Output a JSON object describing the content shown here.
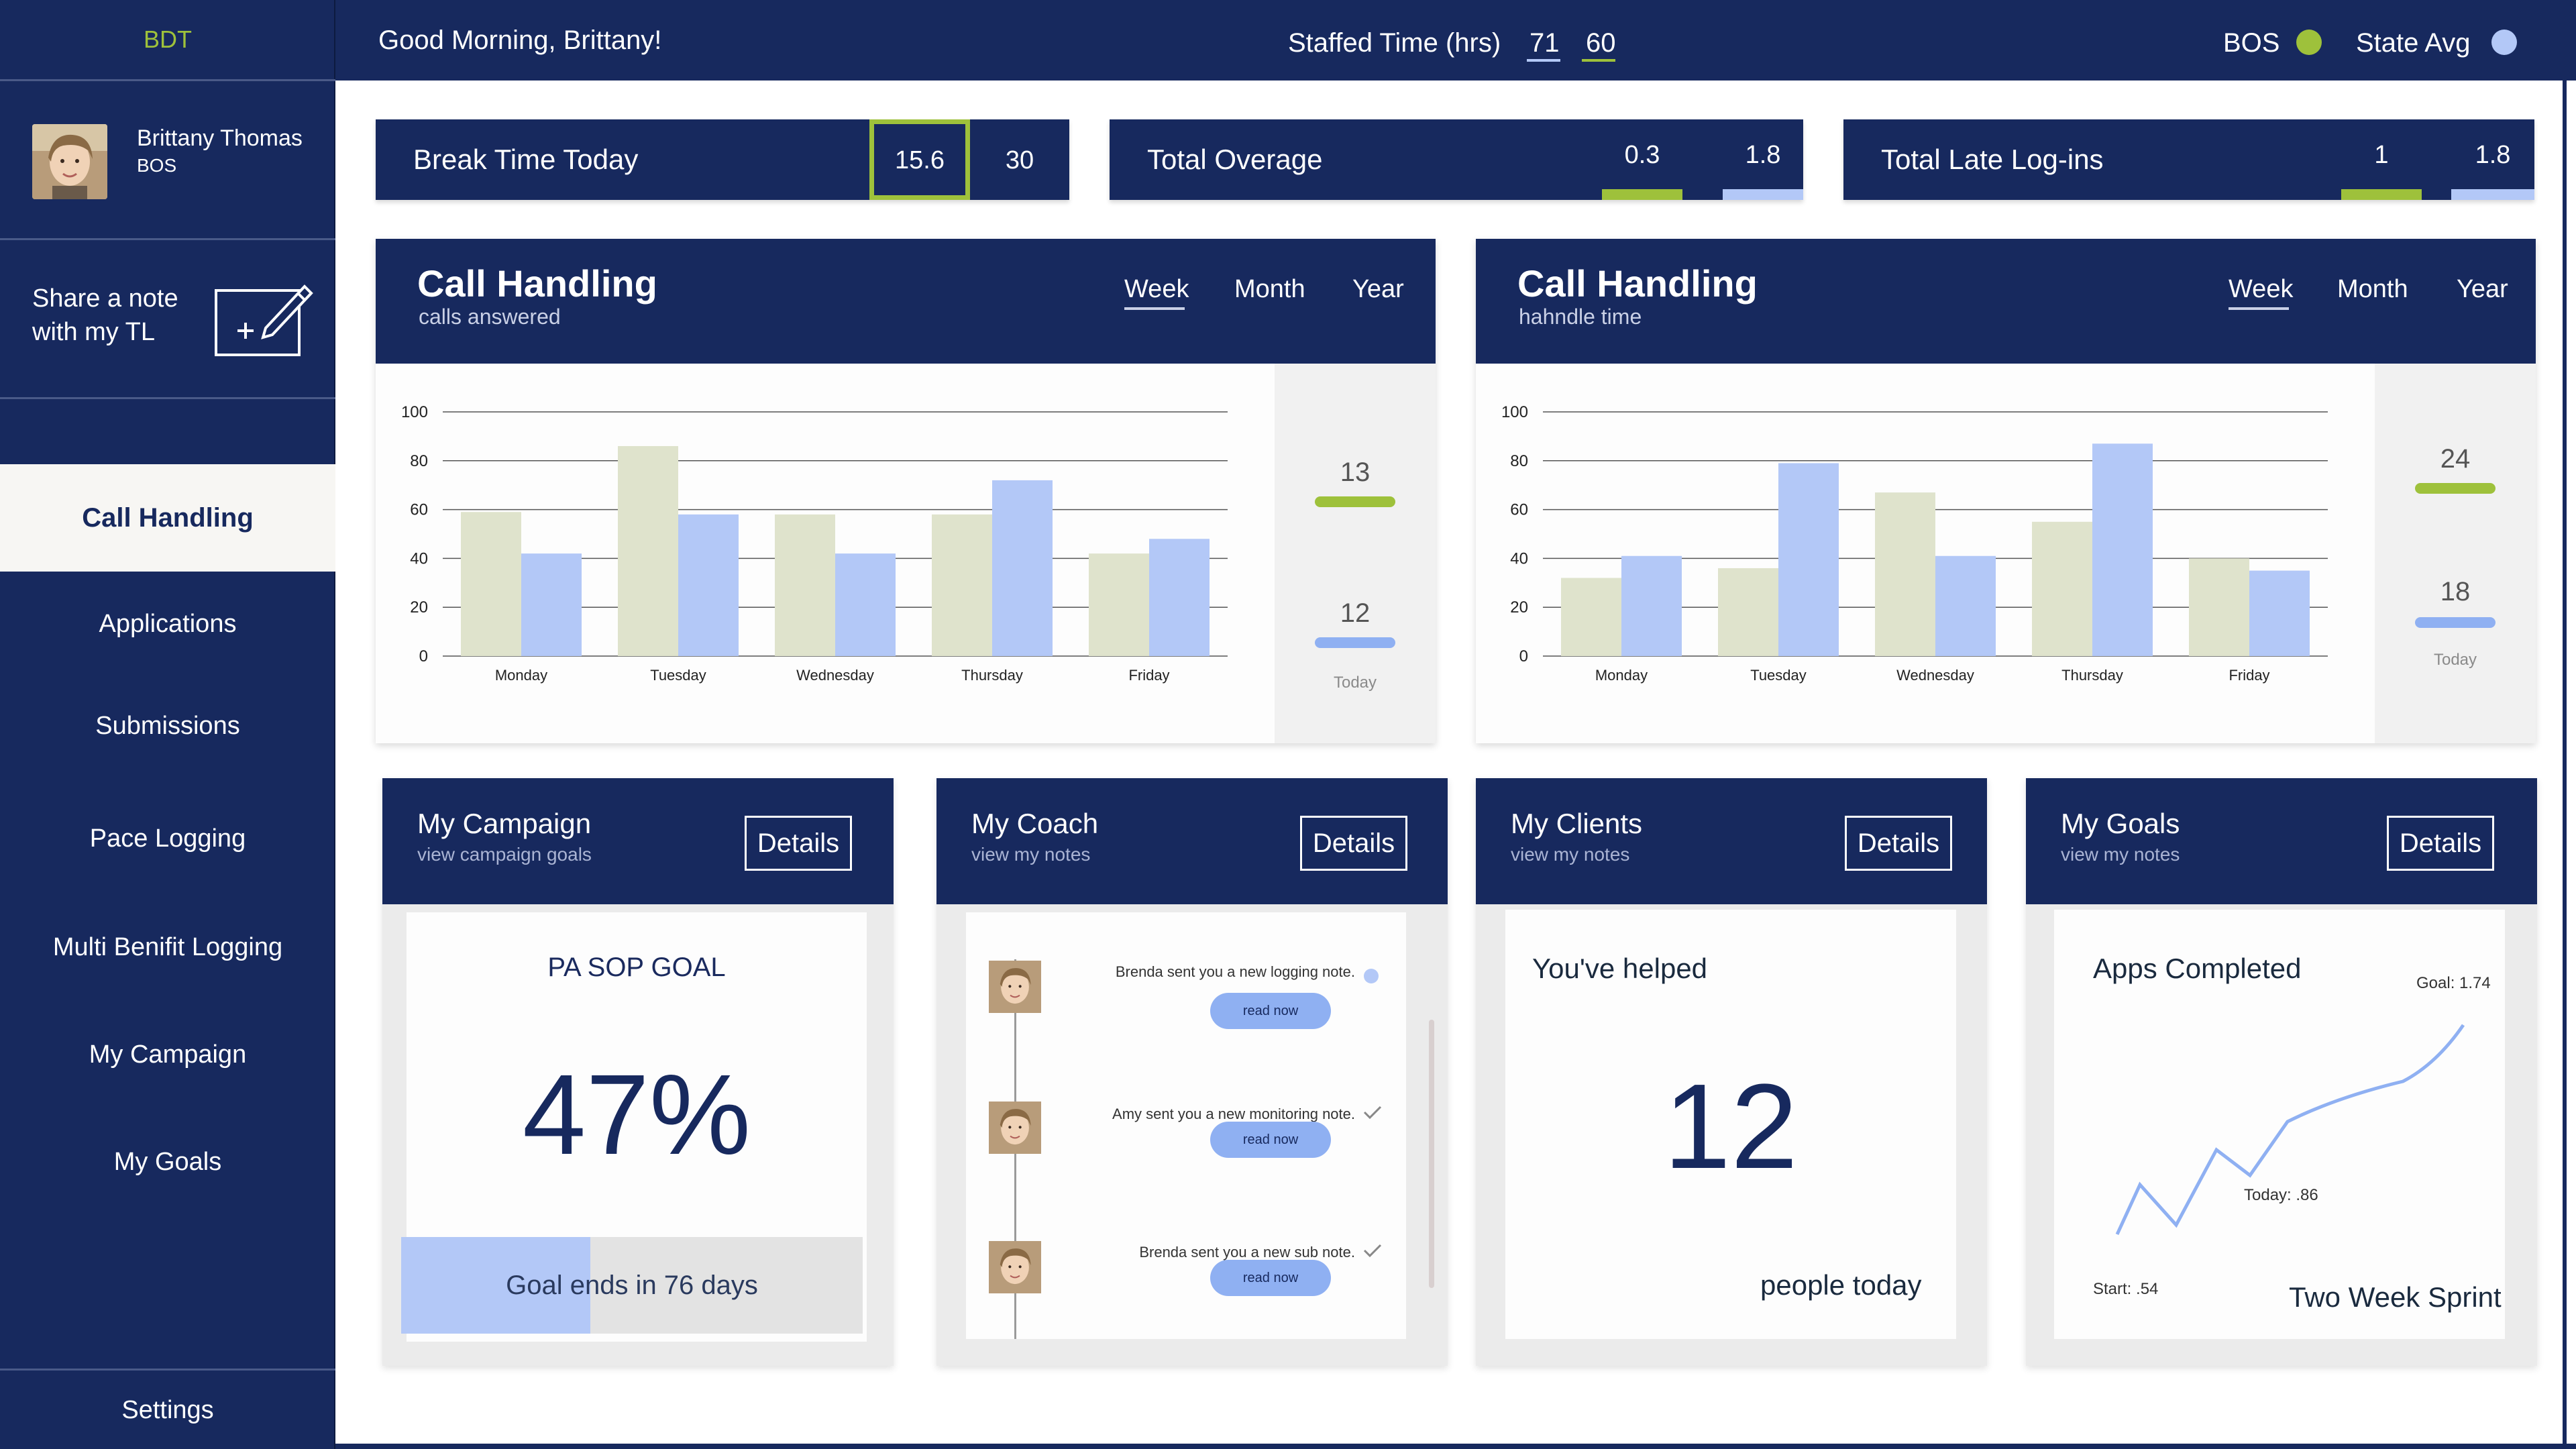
{
  "sidebar": {
    "brand": "BDT",
    "profile": {
      "name": "Brittany Thomas",
      "role": "BOS"
    },
    "share_note": "Share a note with my TL",
    "nav": [
      {
        "label": "Call Handling",
        "active": true
      },
      {
        "label": "Applications"
      },
      {
        "label": "Submissions"
      },
      {
        "label": "Pace Logging"
      },
      {
        "label": "Multi Benifit Logging"
      },
      {
        "label": "My Campaign"
      },
      {
        "label": "My Goals"
      }
    ],
    "settings": "Settings"
  },
  "header": {
    "greeting": "Good Morning, Brittany!",
    "staffed_label": "Staffed Time (hrs)",
    "staffed_state": "71",
    "staffed_bos": "60",
    "bos_label": "BOS",
    "state_label": "State Avg"
  },
  "stats": [
    {
      "label": "Break Time Today",
      "bos": "15.6",
      "state": "30"
    },
    {
      "label": "Total Overage",
      "bos": "0.3",
      "state": "1.8"
    },
    {
      "label": "Total Late Log-ins",
      "bos": "1",
      "state": "1.8"
    }
  ],
  "colors": {
    "navy": "#17295e",
    "bos": "#9ec13b",
    "state": "#b3c8f7",
    "bos_bar": "#dfe3cc"
  },
  "charts": [
    {
      "title": "Call Handling",
      "subtitle": "calls answered",
      "tabs": [
        "Week",
        "Month",
        "Year"
      ],
      "active_tab": "Week",
      "today_bos": "13",
      "today_state": "12",
      "today_label": "Today"
    },
    {
      "title": "Call Handling",
      "subtitle": "hahndle time",
      "tabs": [
        "Week",
        "Month",
        "Year"
      ],
      "active_tab": "Week",
      "today_bos": "24",
      "today_state": "18",
      "today_label": "Today"
    }
  ],
  "chart_data": [
    {
      "type": "bar",
      "categories": [
        "Monday",
        "Tuesday",
        "Wednesday",
        "Thursday",
        "Friday"
      ],
      "series": [
        {
          "values": [
            59,
            86,
            58,
            58,
            42
          ]
        },
        {
          "values": [
            42,
            58,
            42,
            72,
            48
          ]
        }
      ],
      "ylim": [
        0,
        100
      ],
      "yticks": [
        0,
        20,
        40,
        60,
        80,
        100
      ],
      "grid": true
    },
    {
      "type": "bar",
      "categories": [
        "Monday",
        "Tuesday",
        "Wednesday",
        "Thursday",
        "Friday"
      ],
      "series": [
        {
          "values": [
            32,
            36,
            67,
            55,
            40
          ]
        },
        {
          "values": [
            41,
            79,
            41,
            87,
            35
          ]
        }
      ],
      "ylim": [
        0,
        100
      ],
      "yticks": [
        0,
        20,
        40,
        60,
        80,
        100
      ],
      "grid": true
    }
  ],
  "cards": {
    "campaign": {
      "title": "My Campaign",
      "subtitle": "view campaign goals",
      "details": "Details",
      "goal_label": "PA SOP GOAL",
      "percent": "47%",
      "progress": 0.41,
      "ends": "Goal ends in 76 days"
    },
    "coach": {
      "title": "My Coach",
      "subtitle": "view my notes",
      "details": "Details",
      "notes": [
        {
          "text": "Brenda sent you a new logging note.",
          "button": "read now",
          "status": "unread"
        },
        {
          "text": "Amy sent you a new monitoring note.",
          "button": "read now",
          "status": "read"
        },
        {
          "text": "Brenda sent you a new sub note.",
          "button": "read now",
          "status": "read"
        }
      ]
    },
    "clients": {
      "title": "My Clients",
      "subtitle": "view my notes",
      "details": "Details",
      "helped": "You've helped",
      "count": "12",
      "footer": "people today"
    },
    "goals": {
      "title": "My Goals",
      "subtitle": "view my notes",
      "details": "Details",
      "heading": "Apps Completed",
      "goal_label": "Goal: 1.74",
      "today_label": "Today: .86",
      "start_label": "Start: .54",
      "sprint": "Two Week Sprint"
    }
  }
}
